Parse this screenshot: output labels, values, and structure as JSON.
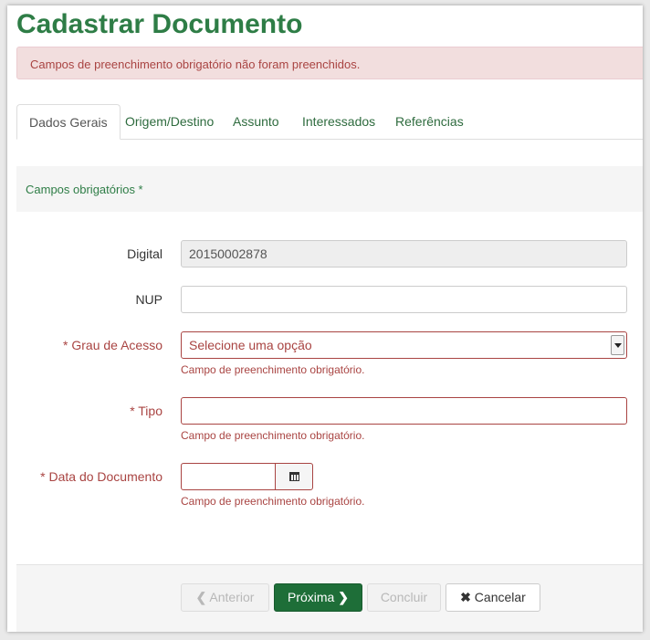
{
  "page": {
    "title": "Cadastrar Documento"
  },
  "alert": {
    "message": "Campos de preenchimento obrigatório não foram preenchidos."
  },
  "tabs": [
    {
      "label": "Dados Gerais"
    },
    {
      "label": "Origem/Destino"
    },
    {
      "label": "Assunto"
    },
    {
      "label": "Interessados"
    },
    {
      "label": "Referências"
    }
  ],
  "form": {
    "required_note": "Campos obrigatórios *",
    "digital": {
      "label": "Digital",
      "value": "20150002878"
    },
    "nup": {
      "label": "NUP",
      "value": ""
    },
    "grau_acesso": {
      "label": "* Grau de Acesso",
      "value": "Selecione uma opção",
      "help": "Campo de preenchimento obrigatório."
    },
    "tipo": {
      "label": "* Tipo",
      "value": "",
      "help": "Campo de preenchimento obrigatório."
    },
    "data_documento": {
      "label": "* Data do Documento",
      "value": "",
      "help": "Campo de preenchimento obrigatório."
    }
  },
  "footer": {
    "anterior": "Anterior",
    "proxima": "Próxima",
    "concluir": "Concluir",
    "cancelar": "Cancelar"
  },
  "icons": {
    "prev": "chevron-left-icon",
    "next": "chevron-right-icon",
    "cancel": "times-icon",
    "calendar": "calendar-icon"
  },
  "colors": {
    "brand_green": "#2e7d46",
    "primary_button": "#1e6e38",
    "error": "#a94442",
    "alert_bg": "#f2dede"
  }
}
